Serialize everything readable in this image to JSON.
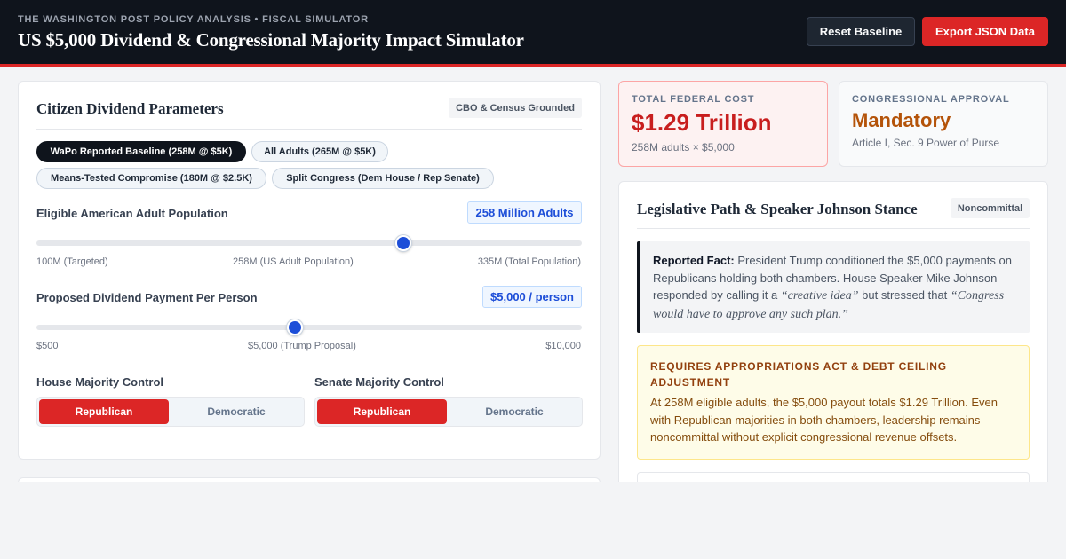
{
  "header": {
    "eyebrow": "THE WASHINGTON POST POLICY ANALYSIS • FISCAL SIMULATOR",
    "title": "US $5,000 Dividend & Congressional Majority Impact Simulator",
    "reset_label": "Reset Baseline",
    "export_label": "Export JSON Data"
  },
  "params": {
    "title": "Citizen Dividend Parameters",
    "badge": "CBO & Census Grounded",
    "presets": [
      {
        "label": "WaPo Reported Baseline (258M @ $5K)",
        "active": true
      },
      {
        "label": "All Adults (265M @ $5K)",
        "active": false
      },
      {
        "label": "Means-Tested Compromise (180M @ $2.5K)",
        "active": false
      },
      {
        "label": "Split Congress (Dem House / Rep Senate)",
        "active": false
      }
    ],
    "population": {
      "label": "Eligible American Adult Population",
      "value_text": "258 Million Adults",
      "value": 258,
      "min": 100,
      "max": 335,
      "ticks": [
        "100M (Targeted)",
        "258M (US Adult Population)",
        "335M (Total Population)"
      ]
    },
    "payment": {
      "label": "Proposed Dividend Payment Per Person",
      "value_text": "$5,000 / person",
      "value": 5000,
      "min": 500,
      "max": 10000,
      "ticks": [
        "$500",
        "$5,000 (Trump Proposal)",
        "$10,000"
      ]
    },
    "house": {
      "label": "House Majority Control",
      "options": [
        "Republican",
        "Democratic"
      ],
      "selected": "Republican"
    },
    "senate": {
      "label": "Senate Majority Control",
      "options": [
        "Republican",
        "Democratic"
      ],
      "selected": "Republican"
    }
  },
  "stats": {
    "cost": {
      "label": "TOTAL FEDERAL COST",
      "value": "$1.29 Trillion",
      "sub": "258M adults × $5,000",
      "color": "#c81e1e"
    },
    "approval": {
      "label": "CONGRESSIONAL APPROVAL",
      "value": "Mandatory",
      "sub": "Article I, Sec. 9 Power of Purse",
      "color": "#b45309"
    }
  },
  "legislative": {
    "title": "Legislative Path & Speaker Johnson Stance",
    "badge": "Noncommittal",
    "fact_label": "Reported Fact:",
    "fact_text_1": " President Trump conditioned the $5,000 payments on Republicans holding both chambers. House Speaker Mike Johnson responded by calling it a ",
    "fact_quote_1": "“creative idea”",
    "fact_text_2": " but stressed that ",
    "fact_quote_2": "“Congress would have to approve any such plan.”",
    "warning_title": "REQUIRES APPROPRIATIONS ACT & DEBT CEILING ADJUSTMENT",
    "warning_body": "At 258M eligible adults, the $5,000 payout totals $1.29 Trillion. Even with Republican majorities in both chambers, leadership remains noncommittal without explicit congressional revenue offsets."
  }
}
